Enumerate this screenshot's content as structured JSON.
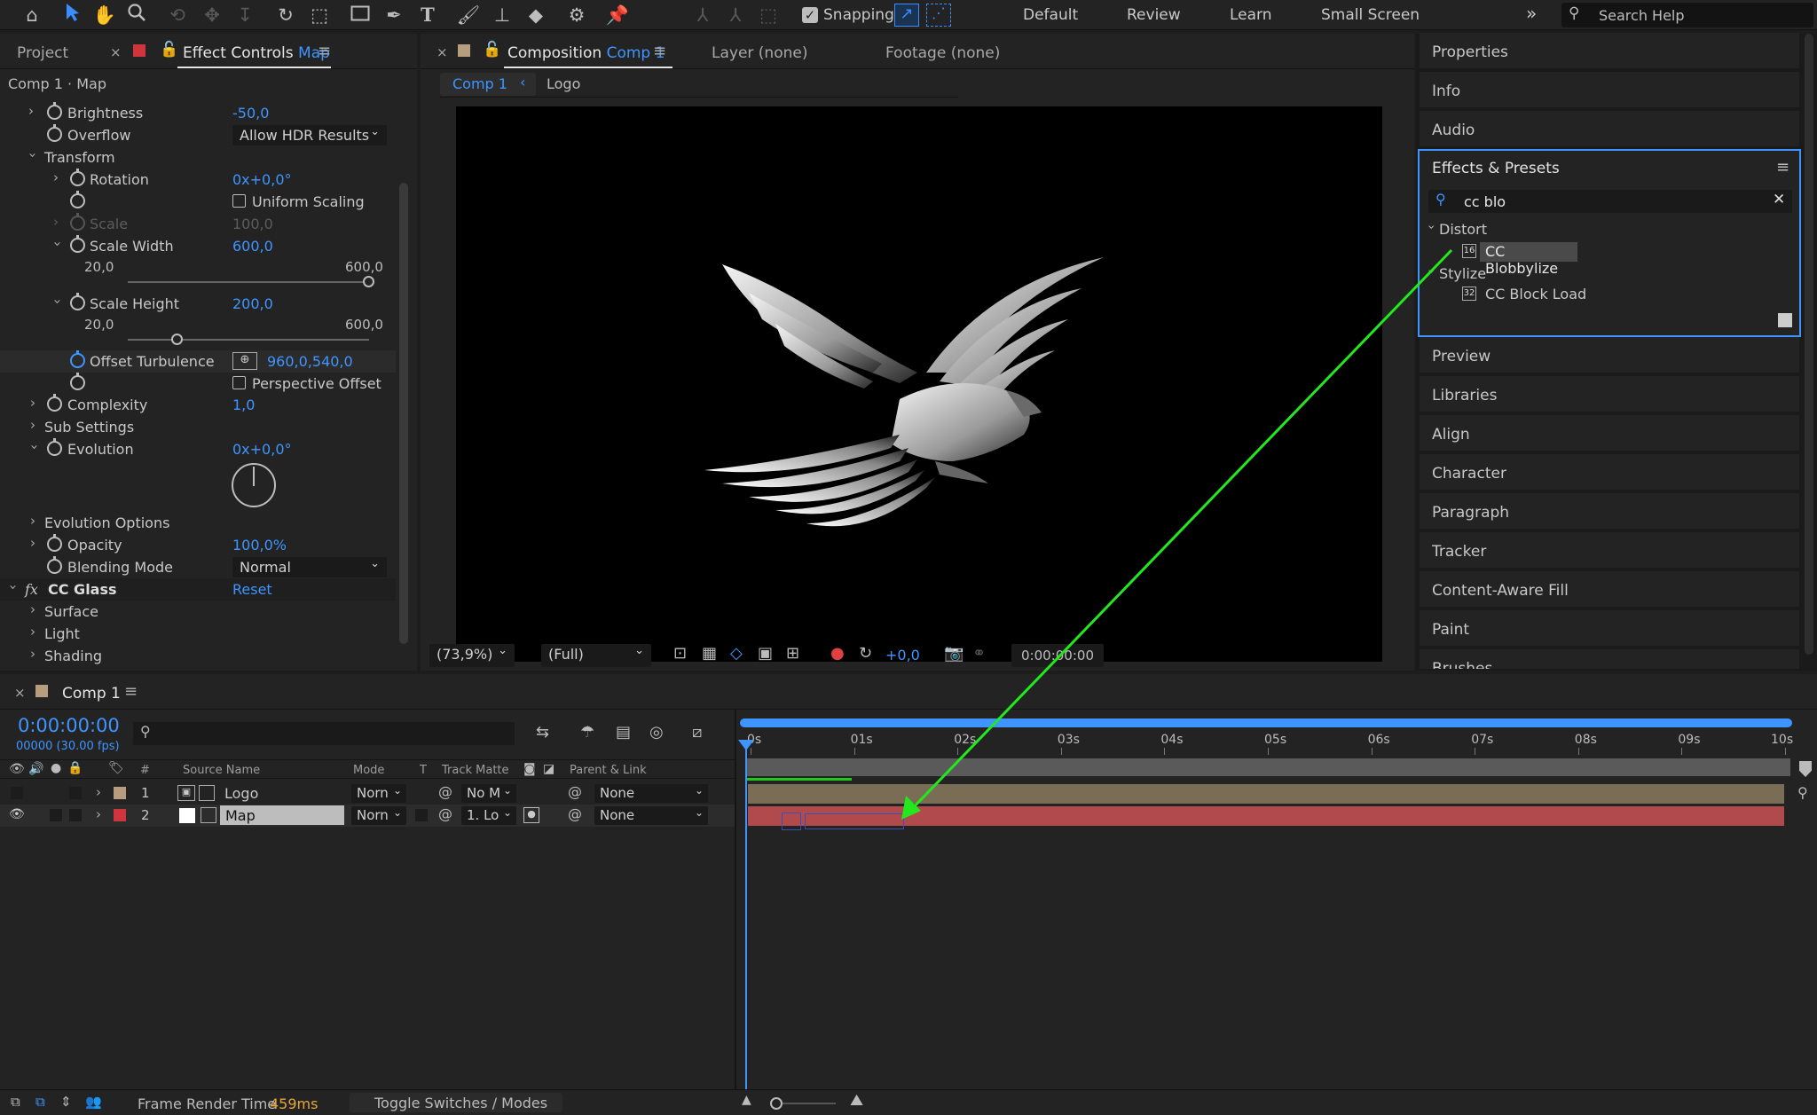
{
  "toolbar": {
    "icons": [
      "home-icon",
      "selection-tool-icon",
      "hand-tool-icon",
      "zoom-tool-icon",
      "orbit-camera-icon",
      "pan-camera-icon",
      "dolly-camera-icon",
      "rotate-tool-icon",
      "pan-behind-tool-icon",
      "rectangle-tool-icon",
      "pen-tool-icon",
      "type-tool-icon",
      "brush-tool-icon",
      "clone-stamp-icon",
      "eraser-icon",
      "roto-brush-icon",
      "puppet-pin-icon"
    ],
    "snapping_label": "Snapping",
    "workspaces": [
      "Default",
      "Review",
      "Learn",
      "Small Screen"
    ],
    "more_glyph": "»",
    "search_placeholder": "Search Help"
  },
  "effect_controls": {
    "tab_project": "Project",
    "tab_prefix": "Effect Controls",
    "tab_layer": "Map",
    "breadcrumb": "Comp 1 · Map",
    "rows": {
      "brightness": {
        "label": "Brightness",
        "value": "-50,0"
      },
      "overflow": {
        "label": "Overflow",
        "value": "Allow HDR Results"
      },
      "transform": {
        "label": "Transform"
      },
      "rotation": {
        "label": "Rotation",
        "value": "0x+0,0°"
      },
      "uniform_scaling": {
        "label": "Uniform Scaling"
      },
      "scale": {
        "label": "Scale",
        "value": "100,0"
      },
      "scale_width": {
        "label": "Scale Width",
        "value": "600,0",
        "min": "20,0",
        "max": "600,0",
        "level": 1.0
      },
      "scale_height": {
        "label": "Scale Height",
        "value": "200,0",
        "min": "20,0",
        "max": "600,0",
        "level": 0.207
      },
      "offset_turbulence": {
        "label": "Offset Turbulence",
        "value": "960,0,540,0"
      },
      "perspective_offset": {
        "label": "Perspective Offset"
      },
      "complexity": {
        "label": "Complexity",
        "value": "1,0"
      },
      "sub_settings": {
        "label": "Sub Settings"
      },
      "evolution": {
        "label": "Evolution",
        "value": "0x+0,0°"
      },
      "evolution_options": {
        "label": "Evolution Options"
      },
      "opacity": {
        "label": "Opacity",
        "value": "100,0%"
      },
      "blending_mode": {
        "label": "Blending Mode",
        "value": "Normal"
      },
      "cc_glass": {
        "label": "CC Glass",
        "reset": "Reset",
        "fx": "fx"
      },
      "surface": {
        "label": "Surface"
      },
      "light": {
        "label": "Light"
      },
      "shading": {
        "label": "Shading"
      }
    }
  },
  "composition": {
    "tab_prefix": "Composition",
    "tab_comp": "Comp 1",
    "tab_layer": "Layer (none)",
    "tab_footage": "Footage (none)",
    "crumb_active": "Comp 1",
    "crumb_next": "Logo",
    "zoom": "(73,9%)",
    "resolution": "(Full)",
    "exposure": "+0,0",
    "timecode": "0:00:00:00"
  },
  "right_panel": {
    "properties": "Properties",
    "info": "Info",
    "audio": "Audio",
    "effects_presets": "Effects & Presets",
    "search_value": "cc blo",
    "categories": [
      {
        "name": "Distort",
        "item": "CC Blobbylize",
        "badge": "16"
      },
      {
        "name": "Stylize",
        "item": "CC Block Load",
        "badge": "32"
      }
    ],
    "panels": [
      "Preview",
      "Libraries",
      "Align",
      "Character",
      "Paragraph",
      "Tracker",
      "Content-Aware Fill",
      "Paint",
      "Brushes"
    ]
  },
  "timeline": {
    "tab": "Comp 1",
    "timecode": "0:00:00:00",
    "frames": "00000 (30.00 fps)",
    "headers": {
      "num": "#",
      "source": "Source Name",
      "mode": "Mode",
      "t": "T",
      "matte": "Track Matte",
      "parent": "Parent & Link"
    },
    "ruler": [
      "0s",
      "01s",
      "02s",
      "03s",
      "04s",
      "05s",
      "06s",
      "07s",
      "08s",
      "09s",
      "10s"
    ],
    "layers": [
      {
        "num": "1",
        "name": "Logo",
        "mode": "Norn",
        "matte": "No M",
        "parent": "None",
        "color": "#b59d7d"
      },
      {
        "num": "2",
        "name": "Map",
        "mode": "Norn",
        "matte": "1. Lo",
        "parent": "None",
        "color": "#c44a4f"
      }
    ]
  },
  "statusbar": {
    "render_label": "Frame Render Time",
    "render_value": "459ms",
    "toggle": "Toggle Switches / Modes"
  },
  "colors": {
    "accent": "#3f95ff",
    "annotation_arrow": "#22e81d",
    "layer_logo": "#7a6d55",
    "layer_map": "#b14a4d"
  }
}
